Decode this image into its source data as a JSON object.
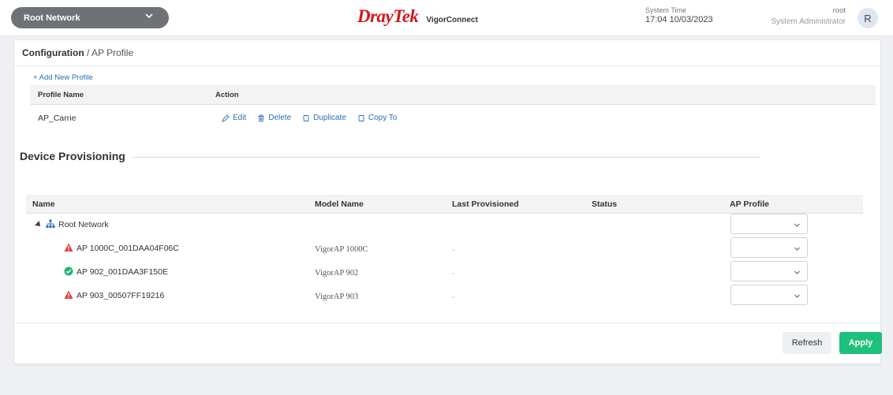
{
  "header": {
    "network_selector": "Root Network",
    "brand": "DrayTek",
    "product": "VigorConnect",
    "system_time_label": "System Time",
    "system_time_value": "17:04 10/03/2023",
    "user_name": "root",
    "user_role": "System Administrator",
    "avatar_letter": "R"
  },
  "breadcrumb": {
    "section": "Configuration",
    "separator": " / ",
    "page": "AP Profile"
  },
  "profiles": {
    "add_label": "+ Add New Profile",
    "columns": [
      "Profile Name",
      "Action"
    ],
    "rows": [
      {
        "name": "AP_Carrie",
        "actions": [
          "Edit",
          "Delete",
          "Duplicate",
          "Copy To"
        ]
      }
    ]
  },
  "device_provisioning": {
    "title": "Device Provisioning",
    "columns": [
      "Name",
      "Model Name",
      "Last Provisioned",
      "Status",
      "AP Profile"
    ],
    "root": {
      "name": "Root Network",
      "icon": "network-tree-icon"
    },
    "devices": [
      {
        "name": "AP 1000C_001DAA04F06C",
        "model": "VigorAP 1000C",
        "last_provisioned": "-",
        "status_icon": "warning-icon",
        "status_color": "#e2413d"
      },
      {
        "name": "AP 902_001DAA3F150E",
        "model": "VigorAP 902",
        "last_provisioned": "-",
        "status_icon": "check-circle-icon",
        "status_color": "#22b573"
      },
      {
        "name": "AP 903_00507FF19216",
        "model": "VigorAP 903",
        "last_provisioned": "-",
        "status_icon": "warning-icon",
        "status_color": "#e2413d"
      }
    ]
  },
  "buttons": {
    "refresh": "Refresh",
    "apply": "Apply"
  },
  "colors": {
    "brand_red": "#d4161c",
    "link_blue": "#2a6fb0",
    "apply_green": "#1ec07d"
  }
}
